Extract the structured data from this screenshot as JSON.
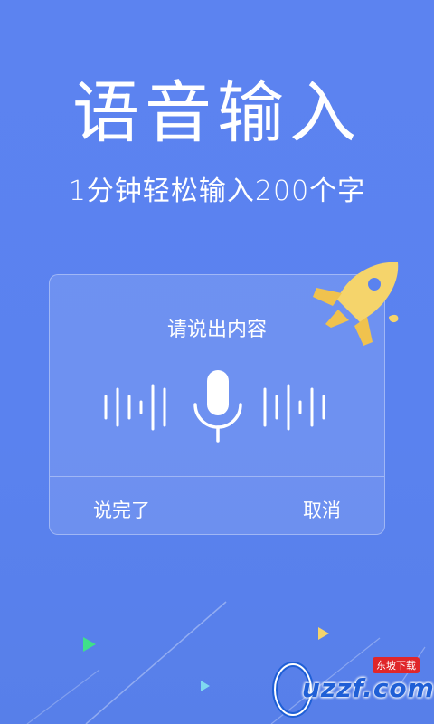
{
  "hero": {
    "title": "语音输入",
    "subtitle": "1分钟轻松输入200个字"
  },
  "dialog": {
    "prompt": "请说出内容",
    "done_label": "说完了",
    "cancel_label": "取消"
  },
  "icons": {
    "mic": "microphone-icon",
    "rocket": "rocket-icon",
    "wave": "sound-wave-icon"
  },
  "watermark": {
    "text": "uzzf.com",
    "badge": "东坡下载"
  },
  "colors": {
    "background": "#5a82ef",
    "rocket": "#f5d46b",
    "triangle_green": "#3fe089",
    "triangle_yellow": "#f5d46b",
    "triangle_cyan": "#7fd8f0"
  }
}
